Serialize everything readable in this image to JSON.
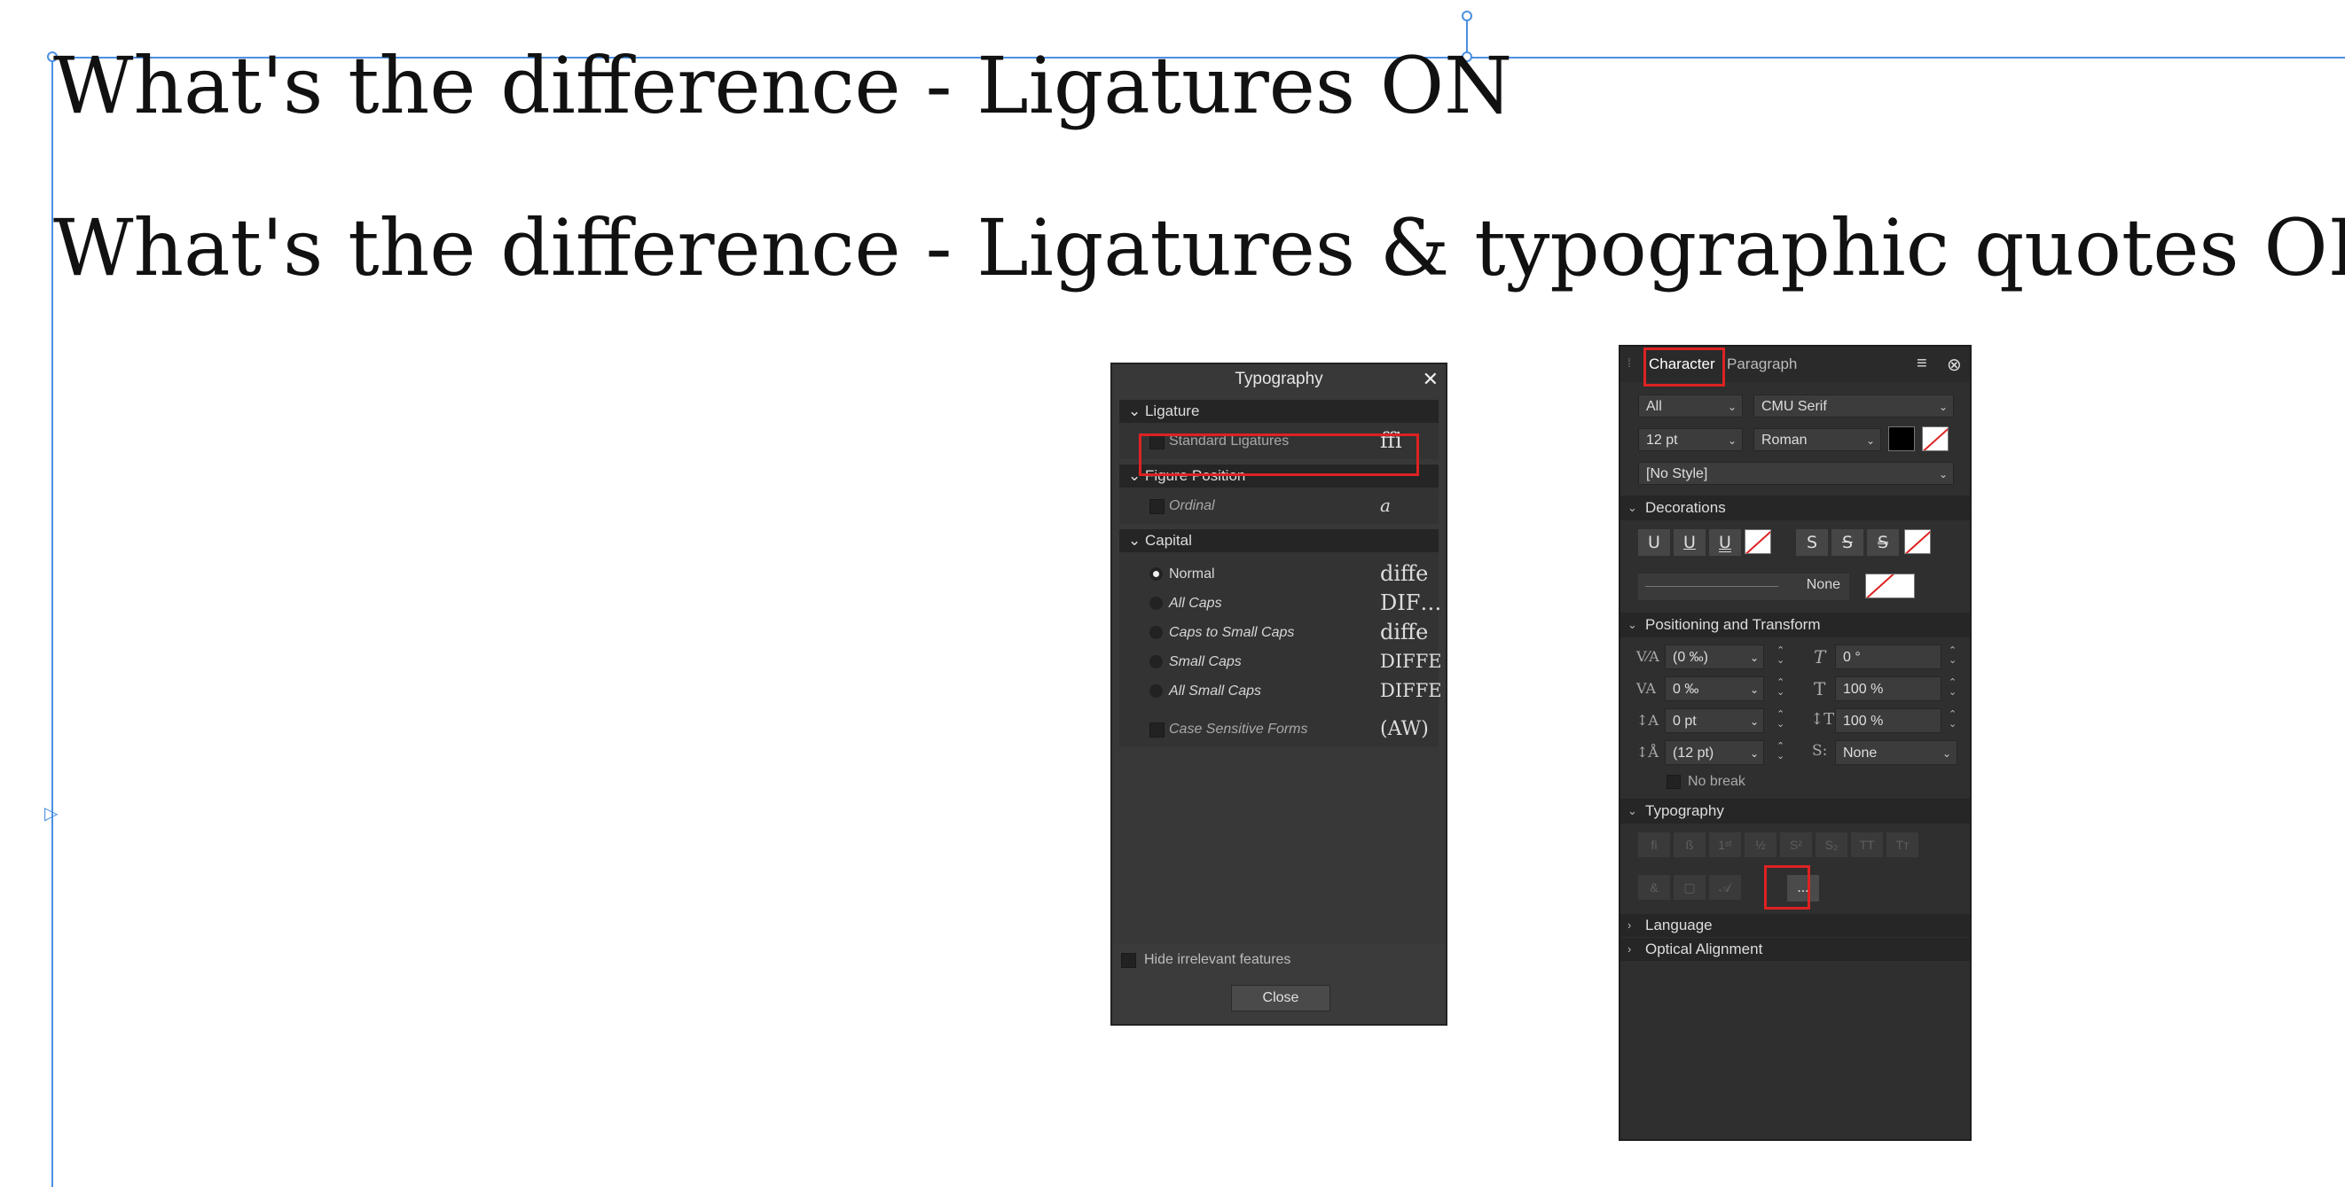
{
  "headlines": {
    "line1": "What's the difference - Ligatures ON",
    "line2": "What's the difference - Ligatures & typographic quotes OFF"
  },
  "typography_dialog": {
    "title": "Typography",
    "close_glyph": "✕",
    "sections": {
      "ligature": {
        "label": "Ligature",
        "option": {
          "label": "Standard Ligatures",
          "checked": false,
          "sample": "ffi"
        }
      },
      "figure_position": {
        "label": "Figure Position",
        "option": {
          "label": "Ordinal",
          "checked": false,
          "sample": "a"
        }
      },
      "capital": {
        "label": "Capital",
        "options": [
          {
            "label": "Normal",
            "selected": true,
            "sample": "diffe"
          },
          {
            "label": "All Caps",
            "selected": false,
            "sample": "DIF…"
          },
          {
            "label": "Caps to Small Caps",
            "selected": false,
            "sample": "diffe"
          },
          {
            "label": "Small Caps",
            "selected": false,
            "sample": "DIFFE"
          },
          {
            "label": "All Small Caps",
            "selected": false,
            "sample": "DIFFE"
          }
        ],
        "case_sensitive": {
          "label": "Case Sensitive Forms",
          "checked": false,
          "sample": "(AW)"
        }
      }
    },
    "hide_irrelevant": "Hide irrelevant features",
    "close_button": "Close"
  },
  "character_panel": {
    "tabs": {
      "character": "Character",
      "paragraph": "Paragraph"
    },
    "menu_icon": "≡",
    "close_icon": "⊗",
    "scope": "All",
    "font_family": "CMU Serif",
    "font_size": "12 pt",
    "font_style": "Roman",
    "fill_color": "#000000",
    "style": "[No Style]",
    "decorations": {
      "label": "Decorations",
      "underline_glyph": "U",
      "strike_glyph": "S",
      "line_style": "None"
    },
    "positioning": {
      "label": "Positioning and Transform",
      "kerning": "(0 ‰)",
      "tracking": "0 ‰",
      "baseline": "0 pt",
      "leading": "(12 pt)",
      "shear": "0 °",
      "horizontal_scale": "100 %",
      "vertical_scale": "100 %",
      "snap": "None",
      "no_break": "No break"
    },
    "typography": {
      "label": "Typography",
      "more_button": "..."
    },
    "language": "Language",
    "optical_alignment": "Optical Alignment"
  }
}
